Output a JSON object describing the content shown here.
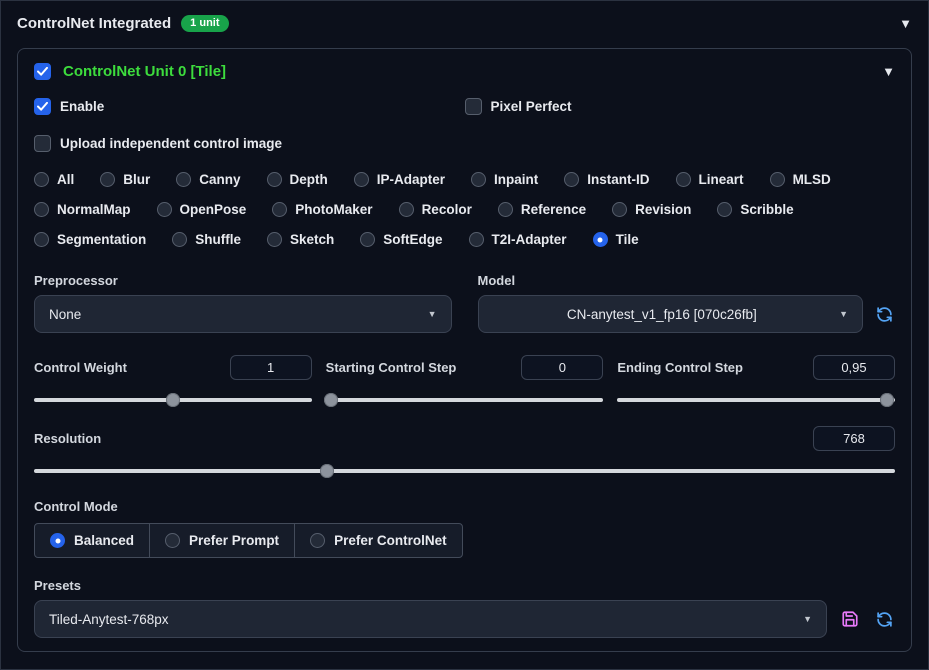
{
  "colors": {
    "accent": "#2563eb",
    "green": "#3ddc3d",
    "badge_green": "#18a34a",
    "icon_save": "#e879f9",
    "icon_refresh": "#54a4f5"
  },
  "header": {
    "title": "ControlNet Integrated",
    "badge": "1 unit"
  },
  "unit": {
    "title": "ControlNet Unit 0 [Tile]",
    "enable": "Enable",
    "pixel_perfect": "Pixel Perfect",
    "upload": "Upload independent control image"
  },
  "control_types": {
    "options": [
      "All",
      "Blur",
      "Canny",
      "Depth",
      "IP-Adapter",
      "Inpaint",
      "Instant-ID",
      "Lineart",
      "MLSD",
      "NormalMap",
      "OpenPose",
      "PhotoMaker",
      "Recolor",
      "Reference",
      "Revision",
      "Scribble",
      "Segmentation",
      "Shuffle",
      "Sketch",
      "SoftEdge",
      "T2I-Adapter",
      "Tile"
    ],
    "selected": "Tile"
  },
  "preprocessor": {
    "label": "Preprocessor",
    "value": "None"
  },
  "model": {
    "label": "Model",
    "value": "CN-anytest_v1_fp16 [070c26fb]"
  },
  "sliders": [
    {
      "label": "Control Weight",
      "value": "1",
      "percent": 50
    },
    {
      "label": "Starting Control Step",
      "value": "0",
      "percent": 2
    },
    {
      "label": "Ending Control Step",
      "value": "0,95",
      "percent": 97
    }
  ],
  "resolution": {
    "label": "Resolution",
    "value": "768",
    "percent": 34
  },
  "control_mode": {
    "label": "Control Mode",
    "options": [
      "Balanced",
      "Prefer Prompt",
      "Prefer ControlNet"
    ],
    "selected": "Balanced"
  },
  "presets": {
    "label": "Presets",
    "value": "Tiled-Anytest-768px"
  }
}
